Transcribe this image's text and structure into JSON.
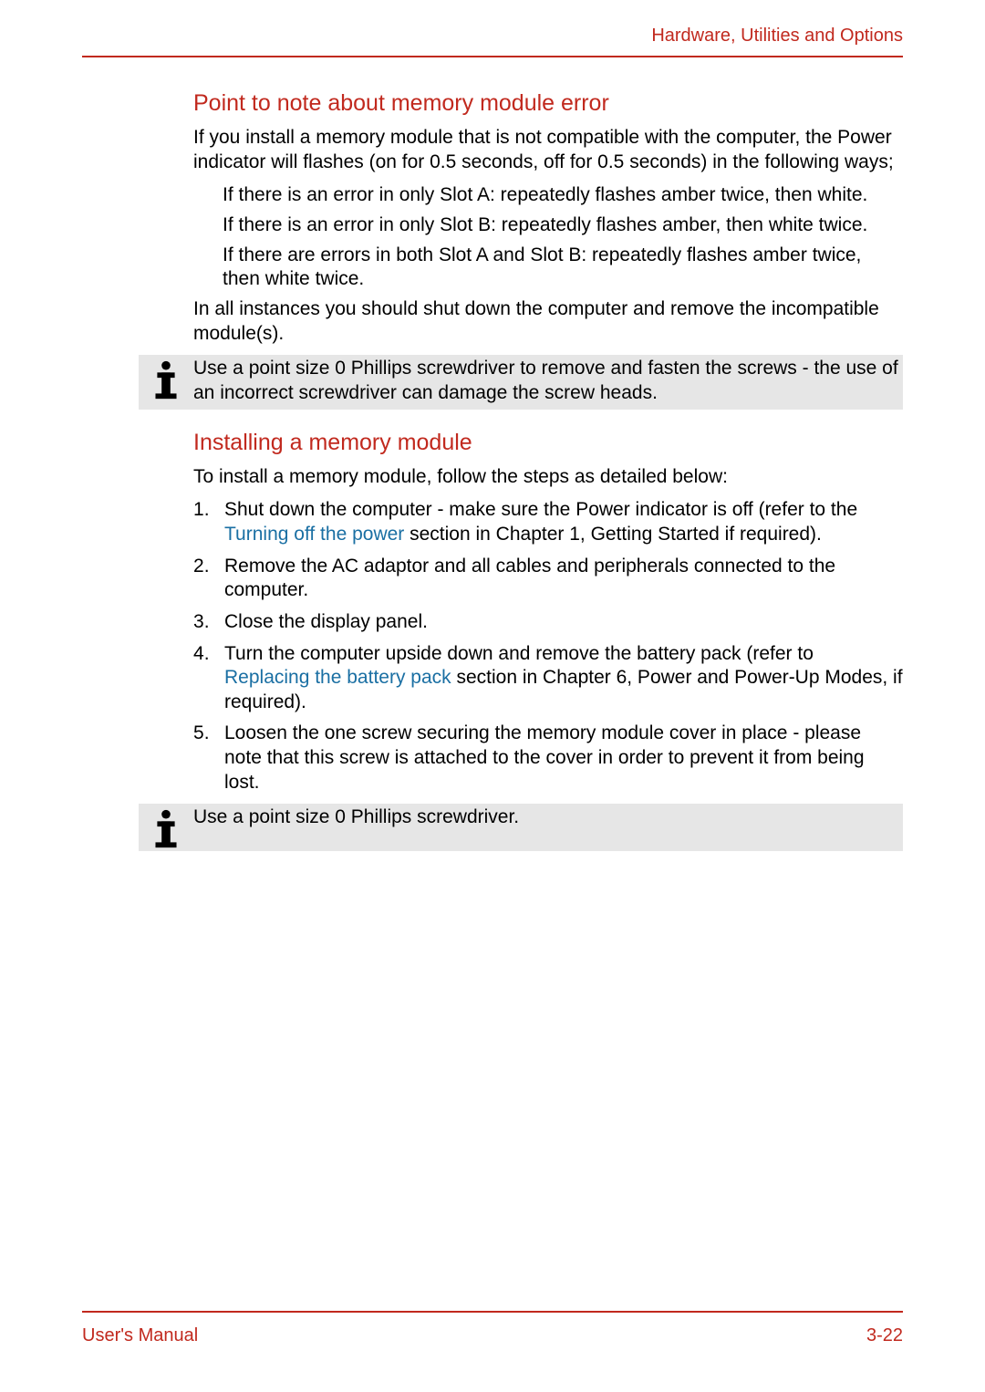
{
  "header": {
    "breadcrumb": "Hardware, Utilities and Options"
  },
  "section1": {
    "title": "Point to note about memory module error",
    "p1": "If you install a memory module that is not compatible with the computer, the Power  indicator will flashes (on for 0.5 seconds, off for 0.5 seconds) in the following ways;",
    "bullets": [
      "If there is an error in only Slot A: repeatedly flashes amber twice, then white.",
      "If there is an error in only Slot B: repeatedly flashes amber, then white twice.",
      "If there are errors in both Slot A and Slot B: repeatedly flashes amber twice, then white twice."
    ],
    "p2": "In all instances you should shut down the computer and remove the incompatible module(s)."
  },
  "info1": {
    "text": "Use a point size 0 Phillips screwdriver to remove and fasten the screws - the use of an incorrect screwdriver can damage the screw heads."
  },
  "section2": {
    "title": "Installing a memory module",
    "intro": "To install a memory module, follow the steps as detailed below:",
    "steps": {
      "s1_a": "Shut down the computer - make sure the Power  indicator is off (refer to the ",
      "s1_link": "Turning off the power",
      "s1_b": " section in Chapter 1, Getting Started if required).",
      "s2": "Remove the AC adaptor and all cables and peripherals connected to the computer.",
      "s3": "Close the display panel.",
      "s4_a": "Turn the computer upside down and remove the battery pack (refer to ",
      "s4_link": "Replacing the battery pack",
      "s4_b": " section in Chapter 6, Power and Power-Up Modes, if required).",
      "s5": "Loosen the one screw securing the memory module cover in place - please note that this screw is attached to the cover in order to prevent it from being lost."
    }
  },
  "info2": {
    "text": "Use a point size 0 Phillips screwdriver."
  },
  "footer": {
    "left": "User's Manual",
    "right": "3-22"
  }
}
